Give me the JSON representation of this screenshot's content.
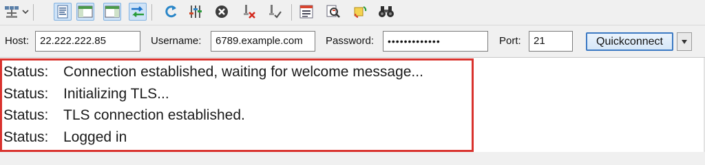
{
  "quickconnect": {
    "host_label": "Host:",
    "host_value": "22.222.222.85",
    "username_label": "Username:",
    "username_value": "6789.example.com",
    "password_label": "Password:",
    "password_value": "•••••••••••••",
    "port_label": "Port:",
    "port_value": "21",
    "button_label": "Quickconnect"
  },
  "log": {
    "lines": [
      {
        "label": "Status:",
        "message": "Connection established, waiting for welcome message..."
      },
      {
        "label": "Status:",
        "message": "Initializing TLS..."
      },
      {
        "label": "Status:",
        "message": "TLS connection established."
      },
      {
        "label": "Status:",
        "message": "Logged in"
      }
    ]
  },
  "toolbar": {
    "icons": [
      "site-manager-icon",
      "toggle-message-log-icon",
      "toggle-local-tree-icon",
      "toggle-remote-tree-icon",
      "toggle-transfer-queue-icon",
      "refresh-icon",
      "process-queue-icon",
      "cancel-operation-icon",
      "disconnect-icon",
      "reconnect-icon",
      "directory-listing-filters-icon",
      "compare-directories-icon",
      "synchronized-browsing-icon",
      "search-remote-files-icon"
    ]
  },
  "colors": {
    "highlight_border": "#d9322d",
    "quickconnect_border": "#3b79c3",
    "toggle_background": "#cfe3f7"
  }
}
